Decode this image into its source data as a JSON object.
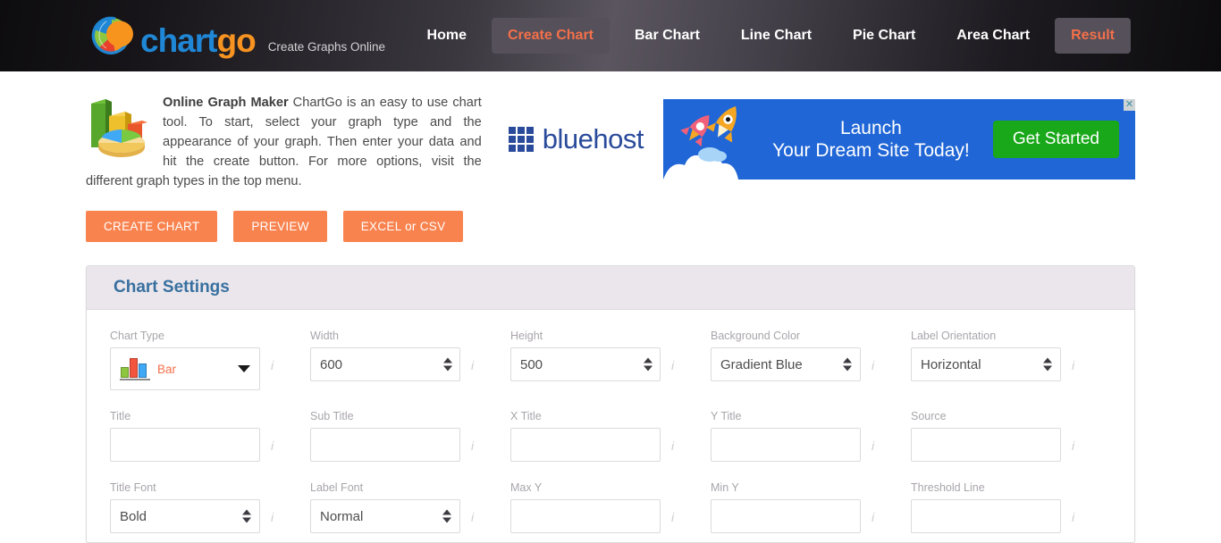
{
  "header": {
    "logo": {
      "part1": "chart",
      "part2": "go",
      "icon": "chartgo-globe-logo"
    },
    "tagline": "Create Graphs Online",
    "nav": [
      {
        "label": "Home",
        "active": false
      },
      {
        "label": "Create Chart",
        "active": true
      },
      {
        "label": "Bar Chart",
        "active": false
      },
      {
        "label": "Line Chart",
        "active": false
      },
      {
        "label": "Pie Chart",
        "active": false
      },
      {
        "label": "Area Chart",
        "active": false
      },
      {
        "label": "Result",
        "active": true
      }
    ]
  },
  "intro": {
    "lead": "Online Graph Maker",
    "body": " ChartGo is an easy to use chart tool. To start, select your graph type and the appearance of your graph. Then enter your data and hit the create button. For more options, visit the different graph types in the top menu.",
    "icon": "bar-and-pie-chart-icon"
  },
  "ad": {
    "sponsor": "bluehost",
    "sponsor_icon": "bluehost-grid-icon",
    "rocket_icon": "rockets-icon",
    "line1": "Launch",
    "line2": "Your Dream Site Today!",
    "cta": "Get Started",
    "close": "✕"
  },
  "actions": [
    {
      "label": "CREATE CHART",
      "name": "create-chart-button"
    },
    {
      "label": "PREVIEW",
      "name": "preview-button"
    },
    {
      "label": "EXCEL or CSV",
      "name": "excel-or-csv-button"
    }
  ],
  "settings": {
    "panel_title": "Chart Settings",
    "info_glyph": "i",
    "fields": {
      "chart_type": {
        "label": "Chart Type",
        "value": "Bar",
        "type": "icon-select"
      },
      "width": {
        "label": "Width",
        "value": "600",
        "type": "number"
      },
      "height": {
        "label": "Height",
        "value": "500",
        "type": "number"
      },
      "background_color": {
        "label": "Background Color",
        "value": "Gradient Blue",
        "type": "select"
      },
      "label_orientation": {
        "label": "Label Orientation",
        "value": "Horizontal",
        "type": "select"
      },
      "title": {
        "label": "Title",
        "value": "",
        "type": "text"
      },
      "sub_title": {
        "label": "Sub Title",
        "value": "",
        "type": "text"
      },
      "x_title": {
        "label": "X Title",
        "value": "",
        "type": "text"
      },
      "y_title": {
        "label": "Y Title",
        "value": "",
        "type": "text"
      },
      "source": {
        "label": "Source",
        "value": "",
        "type": "text"
      },
      "title_font": {
        "label": "Title Font",
        "value": "Bold",
        "type": "select"
      },
      "label_font": {
        "label": "Label Font",
        "value": "Normal",
        "type": "select"
      },
      "max_y": {
        "label": "Max Y",
        "value": "",
        "type": "text"
      },
      "min_y": {
        "label": "Min Y",
        "value": "",
        "type": "text"
      },
      "threshold_line": {
        "label": "Threshold Line",
        "value": "",
        "type": "text"
      }
    }
  },
  "colors": {
    "accent_orange": "#f9834f",
    "nav_active_text": "#f4704a",
    "panel_title_blue": "#37709f",
    "ad_blue": "#2066d6",
    "ad_green": "#19a819",
    "bluehost_blue": "#2a4b9b"
  }
}
